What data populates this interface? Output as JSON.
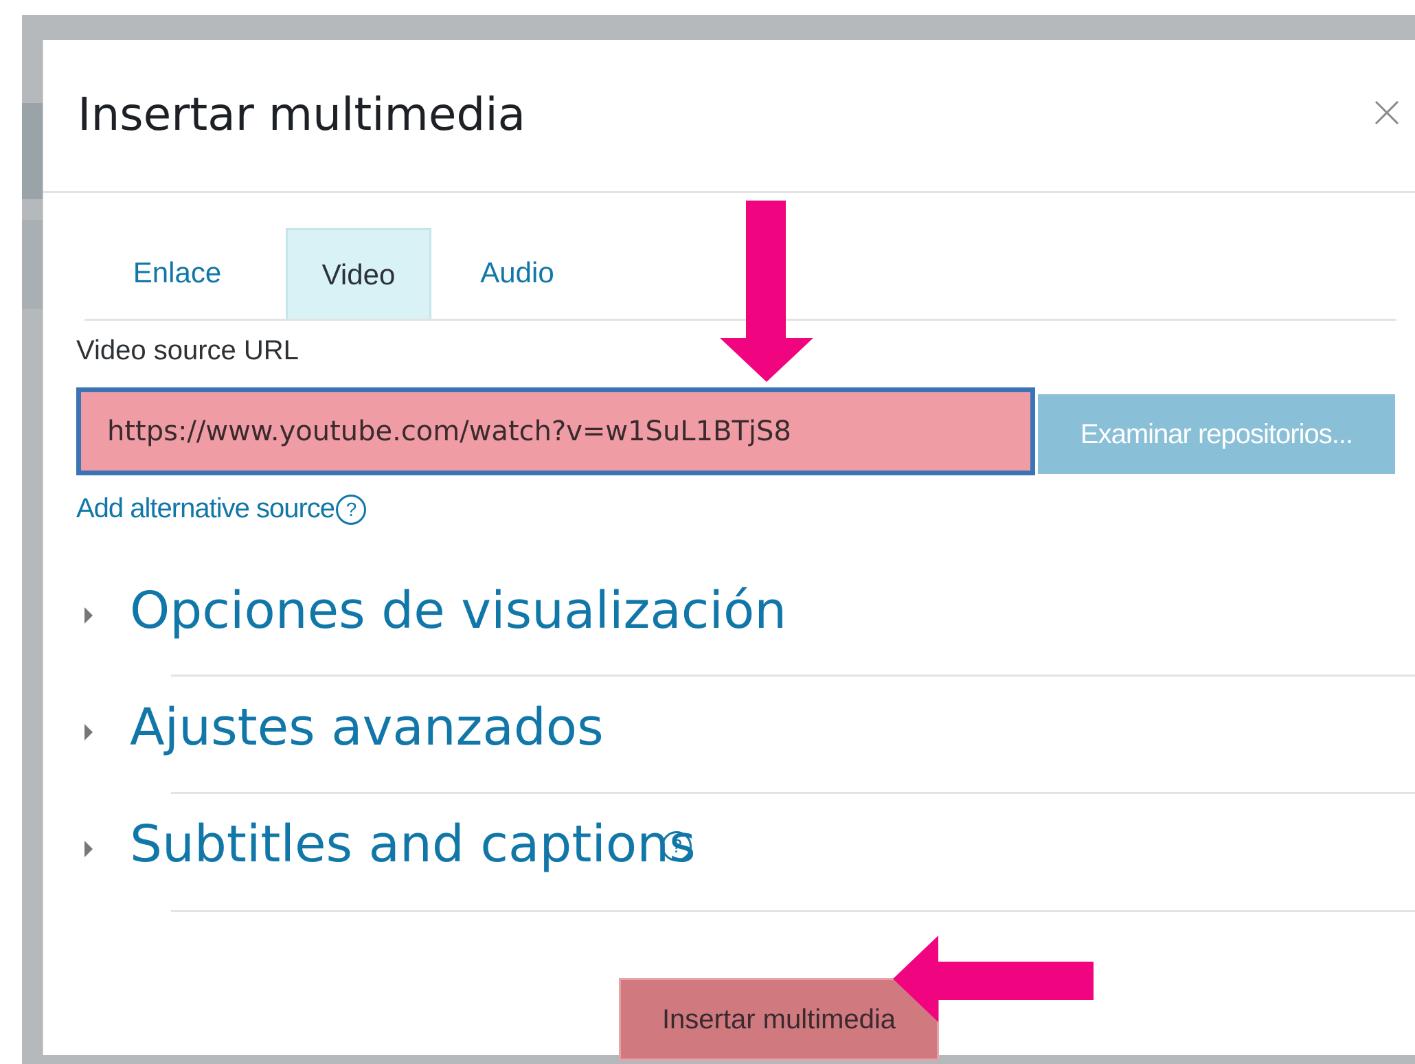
{
  "dialog": {
    "title": "Insertar multimedia",
    "close_icon": "close-icon"
  },
  "tabs": [
    {
      "label": "Enlace",
      "active": false
    },
    {
      "label": "Video",
      "active": true
    },
    {
      "label": "Audio",
      "active": false
    }
  ],
  "video": {
    "source_label": "Video source URL",
    "url_value": "https://www.youtube.com/watch?v=w1SuL1BTjS8",
    "browse_label": "Examinar repositorios...",
    "add_alternative_label": "Add alternative source",
    "help_glyph": "?"
  },
  "sections": [
    {
      "title": "Opciones de visualización"
    },
    {
      "title": "Ajustes avanzados"
    },
    {
      "title": "Subtitles and captions",
      "help": "?"
    }
  ],
  "submit_label": "Insertar multimedia",
  "annotation_color": "#f0047f",
  "accent_color": "#1177a8"
}
